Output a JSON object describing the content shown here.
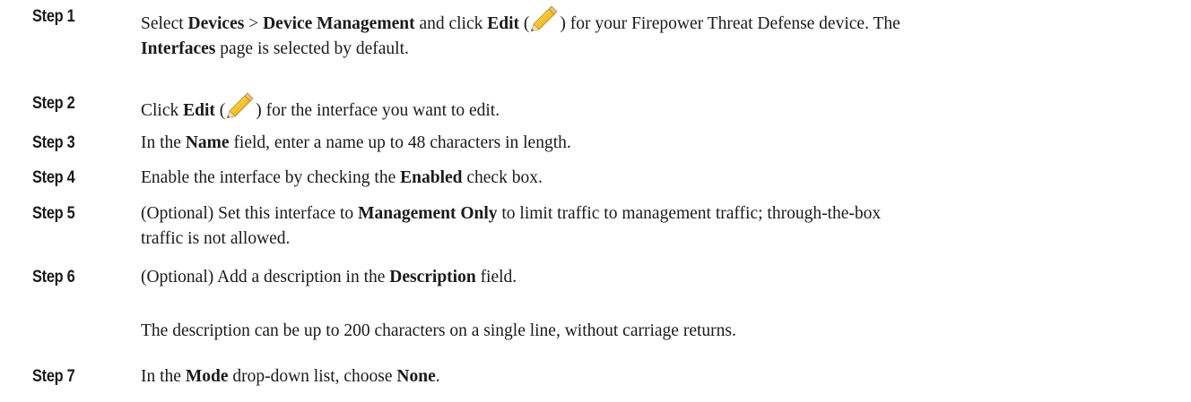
{
  "steps": [
    {
      "label": "Step 1",
      "line1": {
        "t1": "Select ",
        "b1": "Devices",
        "t2": " > ",
        "b2": "Device Management",
        "t3": " and click ",
        "b3": "Edit",
        "t4": " (",
        "t5": ") for your Firepower Threat Defense device. The"
      },
      "line2": {
        "b1": "Interfaces",
        "t1": " page is selected by default."
      }
    },
    {
      "label": "Step 2",
      "t1": "Click ",
      "b1": "Edit",
      "t2": " (",
      "t3": ") for the interface you want to edit."
    },
    {
      "label": "Step 3",
      "t1": "In the ",
      "b1": "Name",
      "t2": " field, enter a name up to 48 characters in length."
    },
    {
      "label": "Step 4",
      "t1": "Enable the interface by checking the ",
      "b1": "Enabled",
      "t2": " check box."
    },
    {
      "label": "Step 5",
      "line1": {
        "t1": "(Optional) Set this interface to ",
        "b1": "Management Only",
        "t2": " to limit traffic to management traffic; through-the-box"
      },
      "line2": {
        "t1": "traffic is not allowed."
      }
    },
    {
      "label": "Step 6",
      "t1": "(Optional) Add a description in the ",
      "b1": "Description",
      "t2": " field.",
      "para2": "The description can be up to 200 characters on a single line, without carriage returns."
    },
    {
      "label": "Step 7",
      "t1": "In the ",
      "b1": "Mode",
      "t2": " drop-down list, choose ",
      "b2": "None",
      "t3": "."
    }
  ],
  "icons": {
    "edit_icon": "pencil-icon",
    "pencil_body_color": "#f2c44a",
    "pencil_tip_color": "#e8d7b0",
    "pencil_lead_color": "#555555",
    "pencil_eraser_color": "#e07a5f"
  }
}
